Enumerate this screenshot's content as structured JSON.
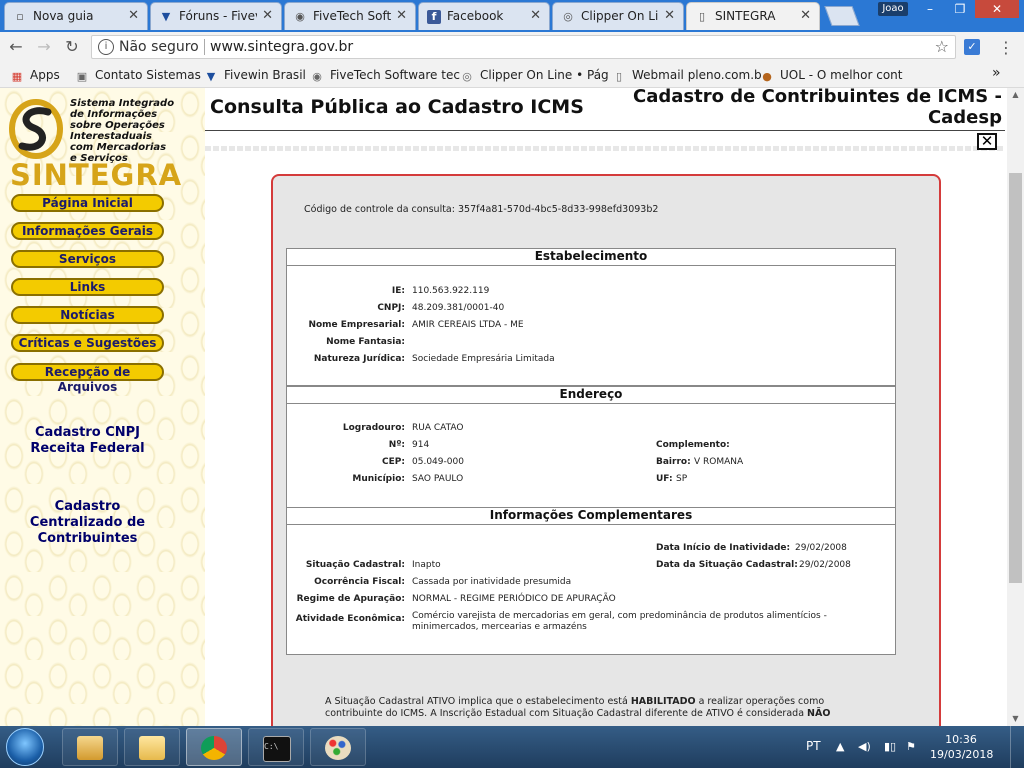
{
  "browser": {
    "tabs": [
      {
        "label": "Nova guia",
        "icon": "blank-page-icon"
      },
      {
        "label": "Fóruns - Fivev",
        "icon": "fivewin-icon"
      },
      {
        "label": "FiveTech Soft",
        "icon": "fivetech-eye-icon"
      },
      {
        "label": "Facebook",
        "icon": "facebook-icon"
      },
      {
        "label": "Clipper On Lin",
        "icon": "clipper-icon"
      },
      {
        "label": "SINTEGRA",
        "icon": "page-icon"
      }
    ],
    "profile": "Joao",
    "window_controls": {
      "minimize": "–",
      "maximize": "❐",
      "close": "✕"
    },
    "address": {
      "security_label": "Não seguro",
      "url": "www.sintegra.gov.br"
    },
    "bookmarks": [
      {
        "label": "Apps",
        "icon": "apps-grid-icon"
      },
      {
        "label": "Contato Sistemas",
        "icon": "contact-icon"
      },
      {
        "label": "Fivewin Brasil",
        "icon": "fivewin-icon"
      },
      {
        "label": "FiveTech Software tec",
        "icon": "fivetech-eye-icon"
      },
      {
        "label": "Clipper On Line • Pág",
        "icon": "clipper-icon"
      },
      {
        "label": "Webmail pleno.com.b",
        "icon": "page-icon"
      },
      {
        "label": "UOL - O melhor cont",
        "icon": "uol-icon"
      }
    ],
    "more_bookmarks": "»"
  },
  "sidebar": {
    "logo_lines": [
      "Sistema Integrado",
      "de Informações",
      "sobre Operações",
      "Interestaduais",
      "com Mercadorias",
      "e Serviços"
    ],
    "logo_word": "SINTEGRA",
    "nav": [
      "Página Inicial",
      "Informações Gerais",
      "Serviços",
      "Links",
      "Notícias",
      "Críticas e Sugestões",
      "Recepção de Arquivos"
    ],
    "link1": [
      "Cadastro CNPJ",
      "Receita Federal"
    ],
    "link2": [
      "Cadastro",
      "Centralizado de",
      "Contribuintes"
    ]
  },
  "page": {
    "heading": "Consulta Pública ao Cadastro ICMS",
    "cadesp_title": "Cadastro de Contribuintes de ICMS - Cadesp",
    "close_symbol": "✕",
    "control_code_label": "Código de controle da consulta:",
    "control_code": "357f4a81-570d-4bc5-8d33-998efd3093b2",
    "estabelecimento": {
      "title": "Estabelecimento",
      "fields": [
        {
          "label": "IE:",
          "value": "110.563.922.119"
        },
        {
          "label": "CNPJ:",
          "value": "48.209.381/0001-40"
        },
        {
          "label": "Nome Empresarial:",
          "value": "AMIR CEREAIS LTDA - ME"
        },
        {
          "label": "Nome Fantasia:",
          "value": ""
        },
        {
          "label": "Natureza Jurídica:",
          "value": "Sociedade Empresária Limitada"
        }
      ]
    },
    "endereco": {
      "title": "Endereço",
      "left": [
        {
          "label": "Logradouro:",
          "value": "RUA CATAO"
        },
        {
          "label": "Nº:",
          "value": "914"
        },
        {
          "label": "CEP:",
          "value": "05.049-000"
        },
        {
          "label": "Município:",
          "value": "SAO PAULO"
        }
      ],
      "right": [
        {
          "label": "Complemento:",
          "value": ""
        },
        {
          "label": "Bairro:",
          "value": "V ROMANA"
        },
        {
          "label": "UF:",
          "value": "SP"
        }
      ]
    },
    "complementares": {
      "title": "Informações Complementares",
      "right": [
        {
          "label": "Data Início de Inatividade:",
          "value": "29/02/2008"
        },
        {
          "label": "Data da Situação Cadastral:",
          "value": "29/02/2008"
        }
      ],
      "left": [
        {
          "label": "Situação Cadastral:",
          "value": "Inapto"
        },
        {
          "label": "Ocorrência Fiscal:",
          "value": "Cassada por inatividade presumida"
        },
        {
          "label": "Regime de Apuração:",
          "value": "NORMAL - REGIME PERIÓDICO DE APURAÇÃO"
        },
        {
          "label": "Atividade Econômica:",
          "value": "Comércio varejista de mercadorias em geral, com predominância de produtos alimentícios -",
          "value2": "minimercados, mercearias e armazéns"
        }
      ]
    },
    "notice": {
      "part1": "A Situação Cadastral ATIVO implica que o estabelecimento está ",
      "bold1": "HABILITADO",
      "part2": " a realizar operações como contribuinte do ICMS. A Inscrição Estadual com Situação Cadastral diferente de ATIVO é considerada ",
      "bold2": "NÃO"
    }
  },
  "taskbar": {
    "language": "PT",
    "time": "10:36",
    "date": "19/03/2018",
    "apps": [
      "outlook-icon",
      "file-explorer-icon",
      "chrome-icon",
      "command-prompt-icon",
      "paint-icon"
    ]
  }
}
